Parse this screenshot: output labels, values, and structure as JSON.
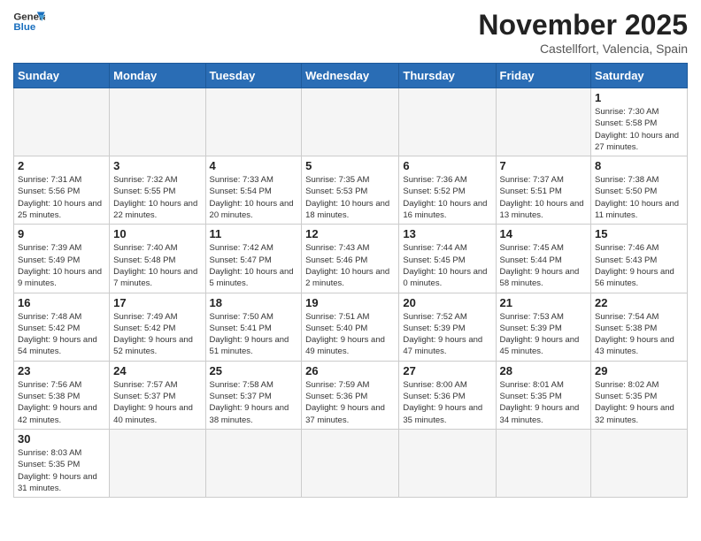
{
  "header": {
    "logo_line1": "General",
    "logo_line2": "Blue",
    "month_title": "November 2025",
    "location": "Castellfort, Valencia, Spain"
  },
  "weekdays": [
    "Sunday",
    "Monday",
    "Tuesday",
    "Wednesday",
    "Thursday",
    "Friday",
    "Saturday"
  ],
  "weeks": [
    [
      {
        "day": "",
        "info": ""
      },
      {
        "day": "",
        "info": ""
      },
      {
        "day": "",
        "info": ""
      },
      {
        "day": "",
        "info": ""
      },
      {
        "day": "",
        "info": ""
      },
      {
        "day": "",
        "info": ""
      },
      {
        "day": "1",
        "info": "Sunrise: 7:30 AM\nSunset: 5:58 PM\nDaylight: 10 hours\nand 27 minutes."
      }
    ],
    [
      {
        "day": "2",
        "info": "Sunrise: 7:31 AM\nSunset: 5:56 PM\nDaylight: 10 hours\nand 25 minutes."
      },
      {
        "day": "3",
        "info": "Sunrise: 7:32 AM\nSunset: 5:55 PM\nDaylight: 10 hours\nand 22 minutes."
      },
      {
        "day": "4",
        "info": "Sunrise: 7:33 AM\nSunset: 5:54 PM\nDaylight: 10 hours\nand 20 minutes."
      },
      {
        "day": "5",
        "info": "Sunrise: 7:35 AM\nSunset: 5:53 PM\nDaylight: 10 hours\nand 18 minutes."
      },
      {
        "day": "6",
        "info": "Sunrise: 7:36 AM\nSunset: 5:52 PM\nDaylight: 10 hours\nand 16 minutes."
      },
      {
        "day": "7",
        "info": "Sunrise: 7:37 AM\nSunset: 5:51 PM\nDaylight: 10 hours\nand 13 minutes."
      },
      {
        "day": "8",
        "info": "Sunrise: 7:38 AM\nSunset: 5:50 PM\nDaylight: 10 hours\nand 11 minutes."
      }
    ],
    [
      {
        "day": "9",
        "info": "Sunrise: 7:39 AM\nSunset: 5:49 PM\nDaylight: 10 hours\nand 9 minutes."
      },
      {
        "day": "10",
        "info": "Sunrise: 7:40 AM\nSunset: 5:48 PM\nDaylight: 10 hours\nand 7 minutes."
      },
      {
        "day": "11",
        "info": "Sunrise: 7:42 AM\nSunset: 5:47 PM\nDaylight: 10 hours\nand 5 minutes."
      },
      {
        "day": "12",
        "info": "Sunrise: 7:43 AM\nSunset: 5:46 PM\nDaylight: 10 hours\nand 2 minutes."
      },
      {
        "day": "13",
        "info": "Sunrise: 7:44 AM\nSunset: 5:45 PM\nDaylight: 10 hours\nand 0 minutes."
      },
      {
        "day": "14",
        "info": "Sunrise: 7:45 AM\nSunset: 5:44 PM\nDaylight: 9 hours\nand 58 minutes."
      },
      {
        "day": "15",
        "info": "Sunrise: 7:46 AM\nSunset: 5:43 PM\nDaylight: 9 hours\nand 56 minutes."
      }
    ],
    [
      {
        "day": "16",
        "info": "Sunrise: 7:48 AM\nSunset: 5:42 PM\nDaylight: 9 hours\nand 54 minutes."
      },
      {
        "day": "17",
        "info": "Sunrise: 7:49 AM\nSunset: 5:42 PM\nDaylight: 9 hours\nand 52 minutes."
      },
      {
        "day": "18",
        "info": "Sunrise: 7:50 AM\nSunset: 5:41 PM\nDaylight: 9 hours\nand 51 minutes."
      },
      {
        "day": "19",
        "info": "Sunrise: 7:51 AM\nSunset: 5:40 PM\nDaylight: 9 hours\nand 49 minutes."
      },
      {
        "day": "20",
        "info": "Sunrise: 7:52 AM\nSunset: 5:39 PM\nDaylight: 9 hours\nand 47 minutes."
      },
      {
        "day": "21",
        "info": "Sunrise: 7:53 AM\nSunset: 5:39 PM\nDaylight: 9 hours\nand 45 minutes."
      },
      {
        "day": "22",
        "info": "Sunrise: 7:54 AM\nSunset: 5:38 PM\nDaylight: 9 hours\nand 43 minutes."
      }
    ],
    [
      {
        "day": "23",
        "info": "Sunrise: 7:56 AM\nSunset: 5:38 PM\nDaylight: 9 hours\nand 42 minutes."
      },
      {
        "day": "24",
        "info": "Sunrise: 7:57 AM\nSunset: 5:37 PM\nDaylight: 9 hours\nand 40 minutes."
      },
      {
        "day": "25",
        "info": "Sunrise: 7:58 AM\nSunset: 5:37 PM\nDaylight: 9 hours\nand 38 minutes."
      },
      {
        "day": "26",
        "info": "Sunrise: 7:59 AM\nSunset: 5:36 PM\nDaylight: 9 hours\nand 37 minutes."
      },
      {
        "day": "27",
        "info": "Sunrise: 8:00 AM\nSunset: 5:36 PM\nDaylight: 9 hours\nand 35 minutes."
      },
      {
        "day": "28",
        "info": "Sunrise: 8:01 AM\nSunset: 5:35 PM\nDaylight: 9 hours\nand 34 minutes."
      },
      {
        "day": "29",
        "info": "Sunrise: 8:02 AM\nSunset: 5:35 PM\nDaylight: 9 hours\nand 32 minutes."
      }
    ],
    [
      {
        "day": "30",
        "info": "Sunrise: 8:03 AM\nSunset: 5:35 PM\nDaylight: 9 hours\nand 31 minutes."
      },
      {
        "day": "",
        "info": ""
      },
      {
        "day": "",
        "info": ""
      },
      {
        "day": "",
        "info": ""
      },
      {
        "day": "",
        "info": ""
      },
      {
        "day": "",
        "info": ""
      },
      {
        "day": "",
        "info": ""
      }
    ]
  ]
}
